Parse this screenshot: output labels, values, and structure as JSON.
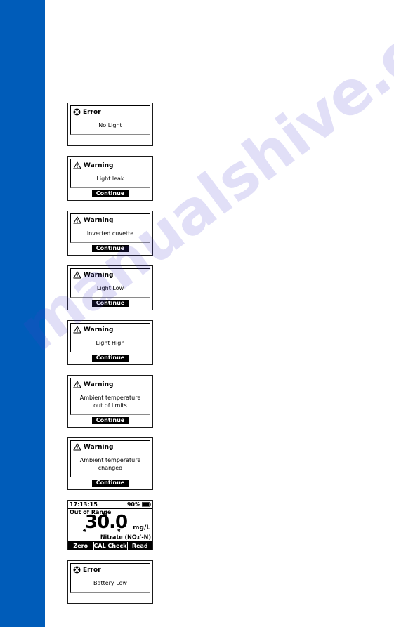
{
  "page": {
    "accent_color": "#005cb9",
    "watermark_text": "manualshive.com"
  },
  "screens": [
    {
      "id": "error-no-light",
      "kind": "dialog",
      "icon": "error-circle-x-icon",
      "title": "Error",
      "lines": [
        "No Light"
      ],
      "button": null
    },
    {
      "id": "warning-light-leak",
      "kind": "dialog",
      "icon": "warning-triangle-icon",
      "title": "Warning",
      "lines": [
        "Light leak"
      ],
      "button": "Continue"
    },
    {
      "id": "warning-inverted-cuvette",
      "kind": "dialog",
      "icon": "warning-triangle-icon",
      "title": "Warning",
      "lines": [
        "Inverted cuvette"
      ],
      "button": "Continue"
    },
    {
      "id": "warning-light-low",
      "kind": "dialog",
      "icon": "warning-triangle-icon",
      "title": "Warning",
      "lines": [
        "Light Low"
      ],
      "button": "Continue"
    },
    {
      "id": "warning-light-high",
      "kind": "dialog",
      "icon": "warning-triangle-icon",
      "title": "Warning",
      "lines": [
        "Light High"
      ],
      "button": "Continue"
    },
    {
      "id": "warning-ambient-temp-out-of-limits",
      "kind": "dialog",
      "icon": "warning-triangle-icon",
      "title": "Warning",
      "lines": [
        "Ambient temperature",
        "out of limits"
      ],
      "button": "Continue"
    },
    {
      "id": "warning-ambient-temp-changed",
      "kind": "dialog",
      "icon": "warning-triangle-icon",
      "title": "Warning",
      "lines": [
        "Ambient temperature",
        "changed"
      ],
      "button": "Continue"
    },
    {
      "id": "measurement-out-of-range",
      "kind": "measurement",
      "time": "17:13:15",
      "battery": "90%",
      "status": "Out of Range",
      "value": "30.0",
      "unit": "mg/L",
      "parameter_name": "Nitrate (NO",
      "parameter_sub": "3",
      "parameter_sup": "-",
      "parameter_tail": "-N)",
      "softkeys": [
        "Zero",
        "CAL Check",
        "Read"
      ]
    },
    {
      "id": "error-battery-low",
      "kind": "dialog",
      "icon": "error-circle-x-icon",
      "title": "Error",
      "lines": [
        "Battery Low"
      ],
      "button": null
    }
  ]
}
